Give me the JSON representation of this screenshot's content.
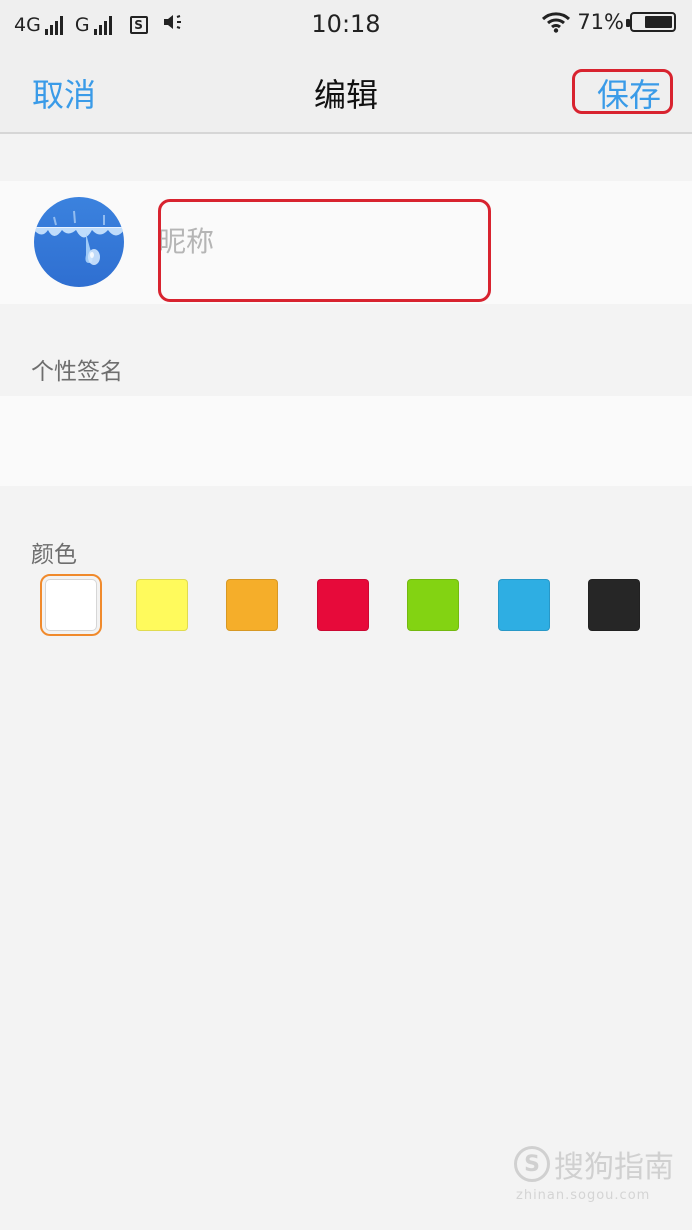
{
  "status_bar": {
    "network1": "4G",
    "network2": "G",
    "sim_icon": "S",
    "time": "10:18",
    "battery_text": "71%",
    "battery_level": 0.71,
    "icons": [
      "signal-icon",
      "sim-icon",
      "vibrate-icon",
      "wifi-icon",
      "battery-icon"
    ]
  },
  "nav": {
    "cancel_label": "取消",
    "title": "编辑",
    "save_label": "保存"
  },
  "profile": {
    "nickname_value": "",
    "nickname_placeholder": "昵称"
  },
  "signature": {
    "label": "个性签名",
    "value": ""
  },
  "colors": {
    "label": "颜色",
    "swatches": [
      "#ffffff",
      "#fffa5c",
      "#f5ae2a",
      "#e70a3a",
      "#83d312",
      "#2eaee3",
      "#262626"
    ],
    "selected_index": 0
  },
  "annotations": {
    "highlight_color": "#d8232f"
  },
  "watermark": {
    "brand": "搜狗指南",
    "url": "zhinan.sogou.com"
  }
}
